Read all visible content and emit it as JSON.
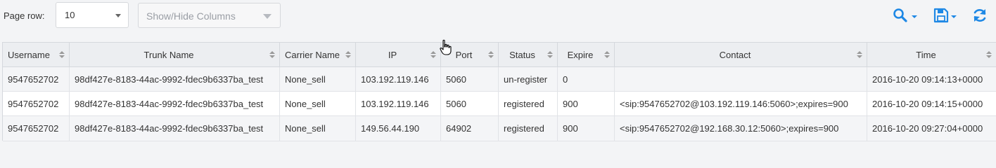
{
  "toolbar": {
    "page_row_label": "Page row:",
    "page_row_value": "10",
    "columns_placeholder": "Show/Hide Columns",
    "accent_color": "#1e88e5"
  },
  "table": {
    "columns": [
      "Username",
      "Trunk Name",
      "Carrier Name",
      "IP",
      "Port",
      "Status",
      "Expire",
      "Contact",
      "Time"
    ],
    "rows": [
      [
        "9547652702",
        "98df427e-8183-44ac-9992-fdec9b6337ba_test",
        "None_sell",
        "103.192.119.146",
        "5060",
        "un-register",
        "0",
        "",
        "2016-10-20 09:14:13+0000"
      ],
      [
        "9547652702",
        "98df427e-8183-44ac-9992-fdec9b6337ba_test",
        "None_sell",
        "103.192.119.146",
        "5060",
        "registered",
        "900",
        "<sip:9547652702@103.192.119.146:5060>;expires=900",
        "2016-10-20 09:14:15+0000"
      ],
      [
        "9547652702",
        "98df427e-8183-44ac-9992-fdec9b6337ba_test",
        "None_sell",
        "149.56.44.190",
        "64902",
        "registered",
        "900",
        "<sip:9547652702@192.168.30.12:5060>;expires=900",
        "2016-10-20 09:27:04+0000"
      ]
    ]
  }
}
